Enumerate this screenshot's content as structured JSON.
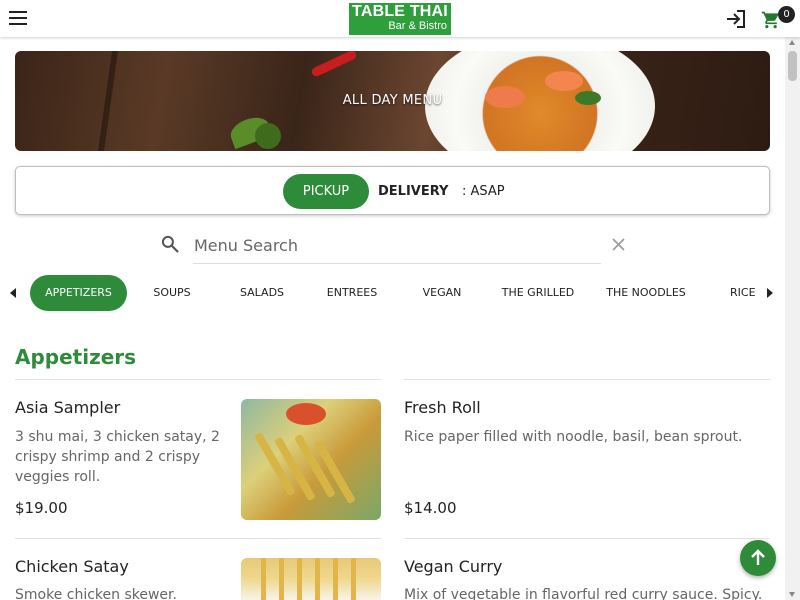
{
  "brand": {
    "name": "TABLE THAI",
    "subtitle": "Bar & Bistro",
    "accent": "#2e8b3a"
  },
  "header": {
    "menu_icon": "hamburger-menu-icon",
    "login_icon": "login-icon",
    "cart_icon": "shopping-cart-icon",
    "cart_count": "0"
  },
  "banner": {
    "text": "ALL DAY MENU"
  },
  "order": {
    "pickup_label": "PICKUP",
    "delivery_label": "DELIVERY",
    "time_label": ": ASAP",
    "selected": "PICKUP"
  },
  "search": {
    "placeholder": "Menu Search",
    "icon": "search-icon",
    "clear_icon": "close-icon"
  },
  "categories": [
    "APPETIZERS",
    "SOUPS",
    "SALADS",
    "ENTREES",
    "VEGAN",
    "THE GRILLED",
    "THE NOODLES",
    "RICE"
  ],
  "active_category": "APPETIZERS",
  "section": {
    "title": "Appetizers"
  },
  "items": [
    {
      "name": "Asia Sampler",
      "description": "3 shu mai, 3 chicken satay, 2 crispy shrimp and 2 crispy veggies roll.",
      "price": "$19.00",
      "has_image": true
    },
    {
      "name": "Fresh Roll",
      "description": "Rice paper filled with noodle, basil, bean sprout.",
      "price": "$14.00",
      "has_image": false
    },
    {
      "name": "Chicken Satay",
      "description": "Smoke chicken skewer. Served",
      "price": "",
      "has_image": true
    },
    {
      "name": "Vegan Curry",
      "description": "Mix of vegetable in flavorful red curry sauce. Spicy.",
      "price": "",
      "has_image": false
    }
  ],
  "scroll_top_icon": "arrow-up-icon"
}
